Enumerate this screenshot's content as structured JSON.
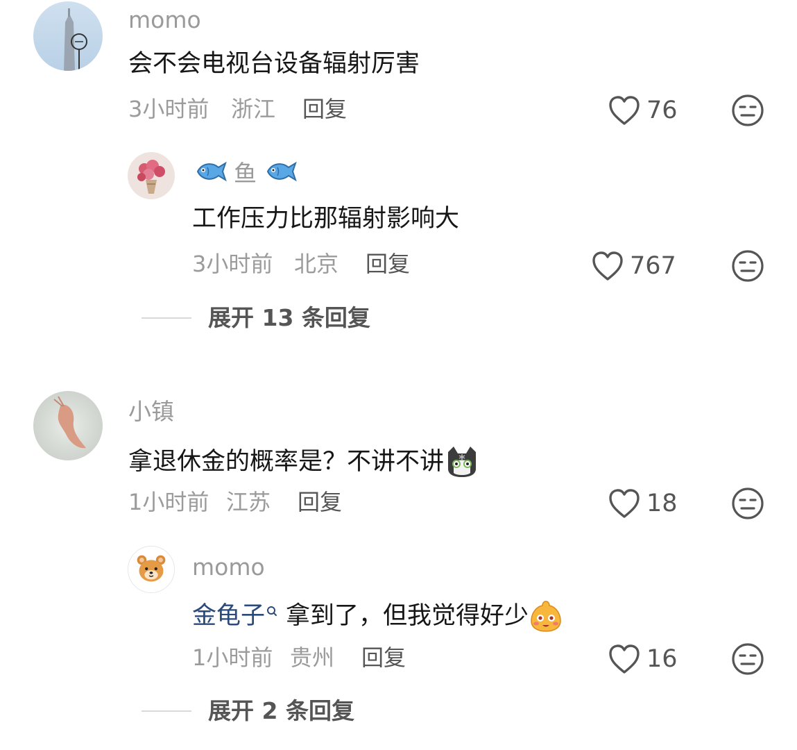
{
  "comments": [
    {
      "username": "momo",
      "text": "会不会电视台设备辐射厉害",
      "time": "3小时前",
      "location": "浙江",
      "reply_label": "回复",
      "likes": "76",
      "avatar": "tower-photo",
      "replies": [
        {
          "username": "鱼",
          "username_decoration": "fish-emoji",
          "text": "工作压力比那辐射影响大",
          "time": "3小时前",
          "location": "北京",
          "reply_label": "回复",
          "likes": "767",
          "avatar": "flower-bouquet-photo"
        }
      ],
      "expand_label": "展开 13 条回复"
    },
    {
      "username": "小镇",
      "text": "拿退休金的概率是？不讲不讲",
      "text_emoji": "cat-emoji",
      "time": "1小时前",
      "location": "江苏",
      "reply_label": "回复",
      "likes": "18",
      "avatar": "shrimp-photo",
      "replies": [
        {
          "username": "momo",
          "mention": "金龟子",
          "text": "拿到了，但我觉得好少",
          "text_emoji": "blushing-face-emoji",
          "time": "1小时前",
          "location": "贵州",
          "reply_label": "回复",
          "likes": "16",
          "avatar": "bear-cartoon"
        }
      ],
      "expand_label": "展开 2 条回复"
    }
  ],
  "colors": {
    "username": "#9a9a9a",
    "text": "#161616",
    "meta": "#9b9b9b",
    "action": "#555555",
    "mention": "#2a4a7a"
  }
}
